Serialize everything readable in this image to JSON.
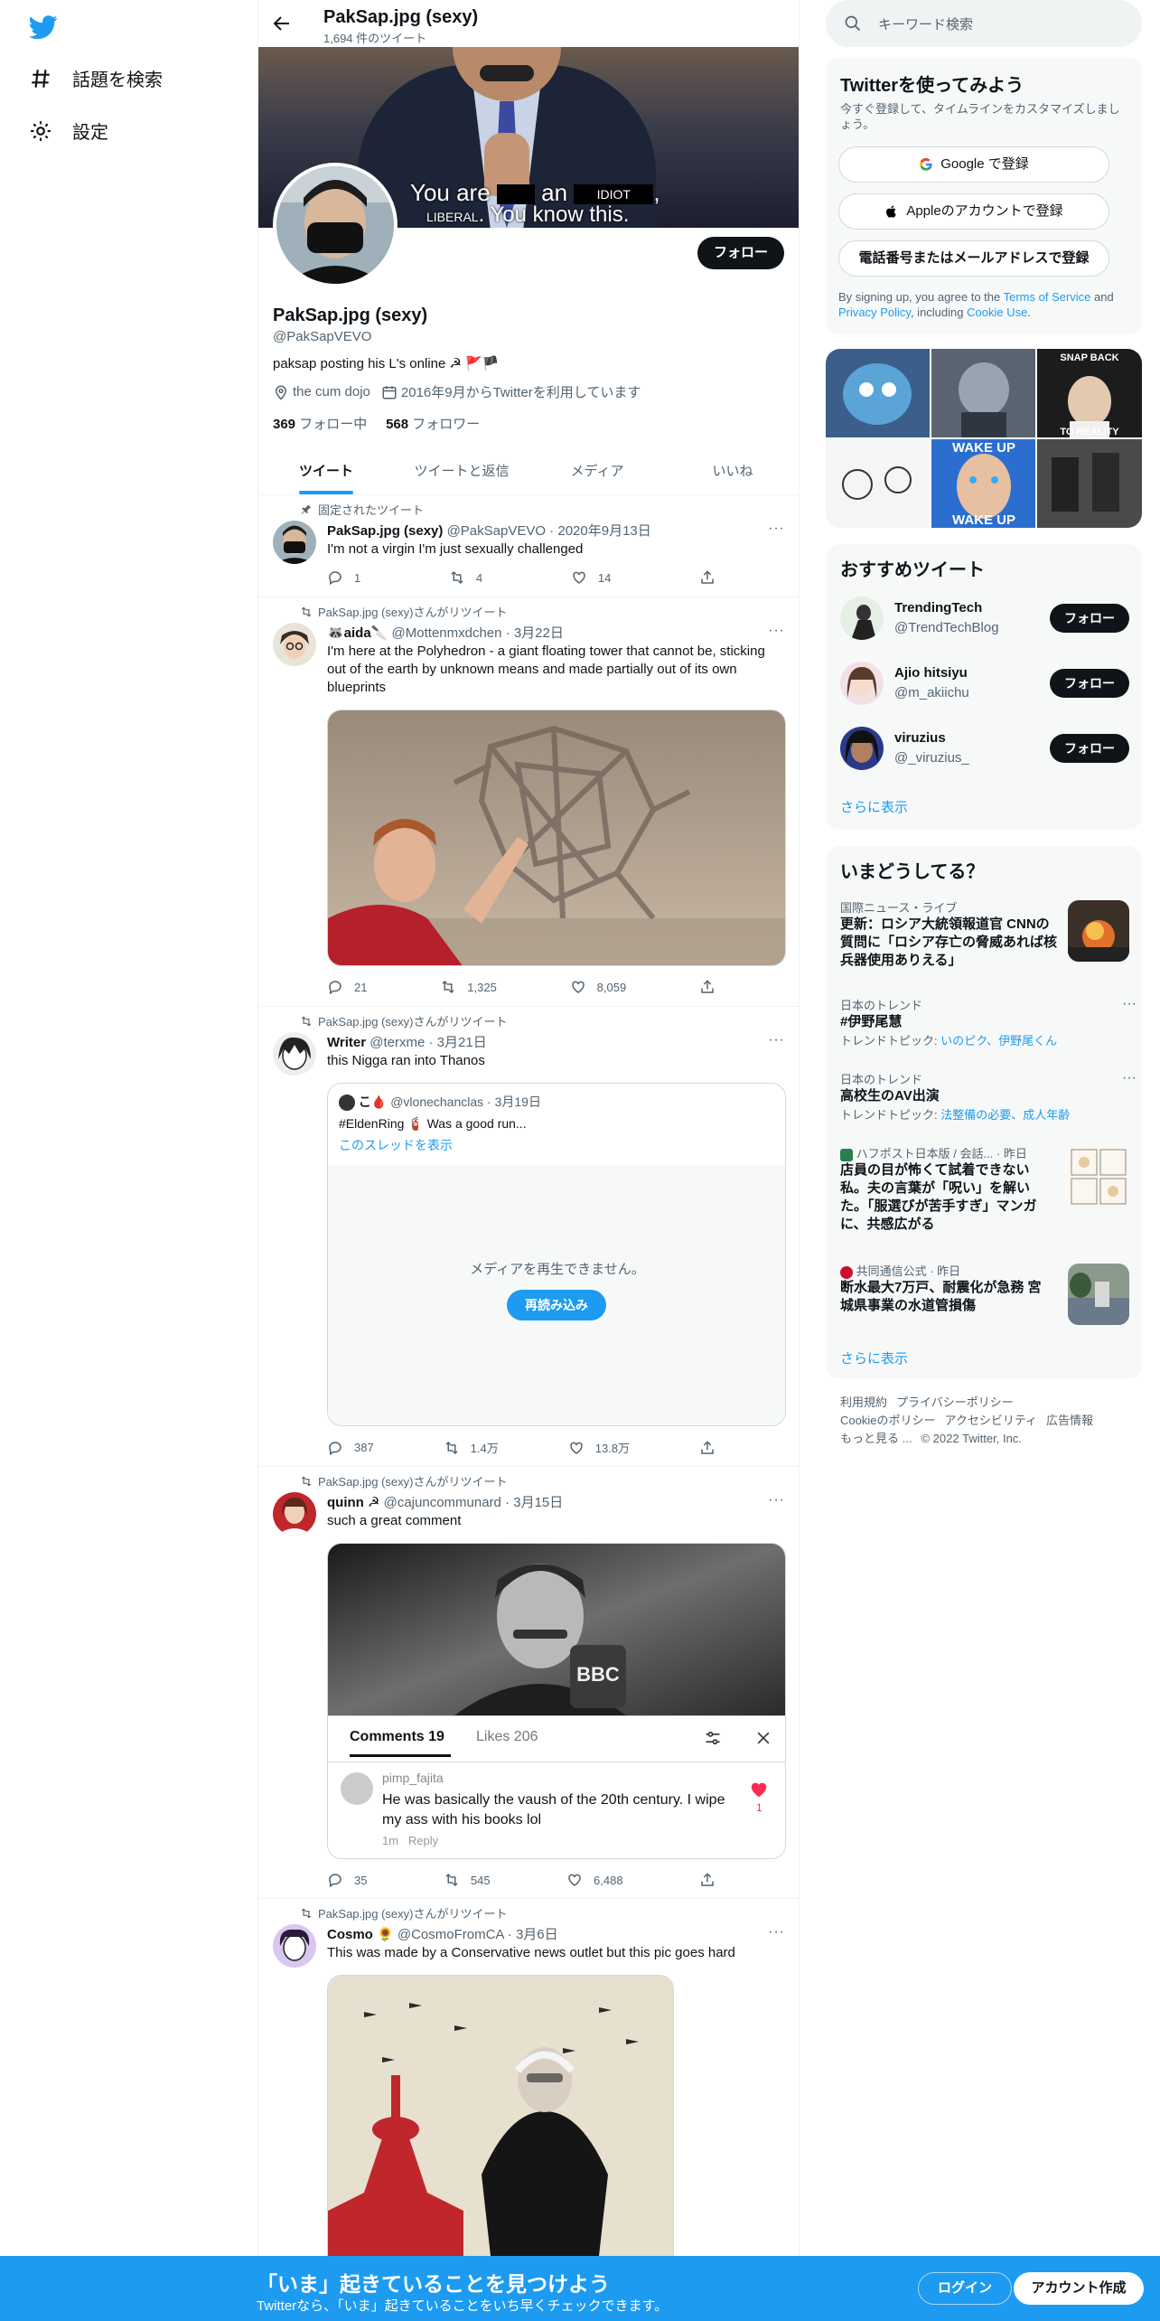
{
  "nav": {
    "explore_label": "話題を検索",
    "settings_label": "設定"
  },
  "header": {
    "title": "PakSap.jpg (sexy)",
    "tweet_count": "1,694 件のツイート"
  },
  "banner": {
    "line1_a": "You are",
    "line1_b": "an",
    "line1_c": "IDIOT",
    "line1_d": ",",
    "line2_a": "LIBERAL",
    "line2_b": ". You know this."
  },
  "profile": {
    "follow_label": "フォロー",
    "name": "PakSap.jpg (sexy)",
    "handle": "@PakSapVEVO",
    "bio": "paksap posting his L's online ☭ 🚩🏴",
    "location": "the cum dojo",
    "joined": "2016年9月からTwitterを利用しています",
    "following_count": "369",
    "following_label": "フォロー中",
    "followers_count": "568",
    "followers_label": "フォロワー"
  },
  "tabs": [
    "ツイート",
    "ツイートと返信",
    "メディア",
    "いいね"
  ],
  "tweets": [
    {
      "context": "固定されたツイート",
      "name": "PakSap.jpg (sexy)",
      "handle": "@PakSapVEVO",
      "date": "2020年9月13日",
      "text": "I'm not a virgin I'm just sexually challenged",
      "replies": "1",
      "retweets": "4",
      "likes": "14"
    },
    {
      "context": "PakSap.jpg (sexy)さんがリツイート",
      "name": "🦝aida🔪",
      "handle": "@Mottenmxdchen",
      "date": "3月22日",
      "text": "I'm here at the Polyhedron - a giant floating tower that cannot be, sticking out of the earth by unknown means and made partially out of its own blueprints",
      "replies": "21",
      "retweets": "1,325",
      "likes": "8,059"
    },
    {
      "context": "PakSap.jpg (sexy)さんがリツイート",
      "name": "Writer",
      "handle": "@terxme",
      "date": "3月21日",
      "text": "this Nigga ran into Thanos",
      "quote_name": "こ🩸",
      "quote_handle": "@vlonechanclas",
      "quote_date": "3月19日",
      "quote_text": "#EldenRing 🧯 Was a good run...",
      "quote_thread": "このスレッドを表示",
      "media_error": "メディアを再生できません。",
      "reload": "再読み込み",
      "replies": "387",
      "retweets": "1.4万",
      "likes": "13.8万"
    },
    {
      "context": "PakSap.jpg (sexy)さんがリツイート",
      "name": "quinn ☭",
      "handle": "@cajuncommunard",
      "date": "3月15日",
      "text": "such a great comment",
      "bbc": "BBC",
      "comments_tab": "Comments 19",
      "likes_tab": "Likes 206",
      "commenter": "pimp_fajita",
      "comment": "He was basically the vaush of the 20th century. I wipe my ass with his books lol",
      "comment_time": "1m",
      "comment_reply": "Reply",
      "comment_likes": "1",
      "replies": "35",
      "retweets": "545",
      "likes": "6,488"
    },
    {
      "context": "PakSap.jpg (sexy)さんがリツイート",
      "name": "Cosmo 🌻",
      "handle": "@CosmoFromCA",
      "date": "3月6日",
      "text": "This was made by a Conservative news outlet but this pic goes hard"
    }
  ],
  "right": {
    "search_placeholder": "キーワード検索",
    "signup_title": "Twitterを使ってみよう",
    "signup_sub": "今すぐ登録して、タイムラインをカスタマイズしましょう。",
    "google": "Google で登録",
    "apple": "Appleのアカウントで登録",
    "phone": "電話番号またはメールアドレスで登録",
    "terms_prefix": "By signing up, you agree to the ",
    "terms": "Terms of Service",
    "terms_and": " and ",
    "privacy": "Privacy Policy",
    "terms_including": ", including ",
    "cookie": "Cookie Use",
    "terms_end": ".",
    "grid_labels": [
      "SNAP BACK",
      "TO REALITY",
      "WAKE UP",
      "WAKE UP"
    ],
    "rec_title": "おすすめツイート",
    "rec_users": [
      {
        "name": "TrendingTech",
        "handle": "@TrendTechBlog"
      },
      {
        "name": "Ajio hitsiyu",
        "handle": "@m_akiichu"
      },
      {
        "name": "viruzius",
        "handle": "@_viruzius_"
      }
    ],
    "rec_follow": "フォロー",
    "show_more": "さらに表示",
    "trends_title": "いまどうしてる？",
    "trends": [
      {
        "cat": "国際ニュース・ライブ",
        "title": "更新：ロシア大統領報道官 CNNの質問に「ロシア存亡の脅威あれば核兵器使用ありえる」"
      },
      {
        "cat": "日本のトレンド",
        "title": "#伊野尾慧",
        "topic_label": "トレンドトピック: ",
        "topic": "いのピク、伊野尾くん"
      },
      {
        "cat": "日本のトレンド",
        "title": "高校生のAV出演",
        "topic_label": "トレンドトピック: ",
        "topic": "法整備の必要、成人年齢"
      },
      {
        "cat": "ハフポスト日本版 / 会話... · 昨日",
        "title": "店員の目が怖くて試着できない私。夫の言葉が「呪い」を解いた。「服選びが苦手すぎ」マンガに、共感広がる"
      },
      {
        "cat": "共同通信公式 · 昨日",
        "title": "断水最大7万戸、耐震化が急務 宮城県事業の水道管損傷"
      }
    ],
    "footer_links": [
      "利用規約",
      "プライバシーポリシー",
      "Cookieのポリシー",
      "アクセシビリティ",
      "広告情報",
      "もっと見る ...",
      "© 2022 Twitter, Inc."
    ]
  },
  "bottom": {
    "title": "「いま」起きていることを見つけよう",
    "sub": "Twitterなら、「いま」起きていることをいち早くチェックできます。",
    "login": "ログイン",
    "signup": "アカウント作成"
  },
  "colors": {
    "accent": "#1d9bf0",
    "text": "#0f1419",
    "secondary": "#536471",
    "like": "#f91880"
  }
}
